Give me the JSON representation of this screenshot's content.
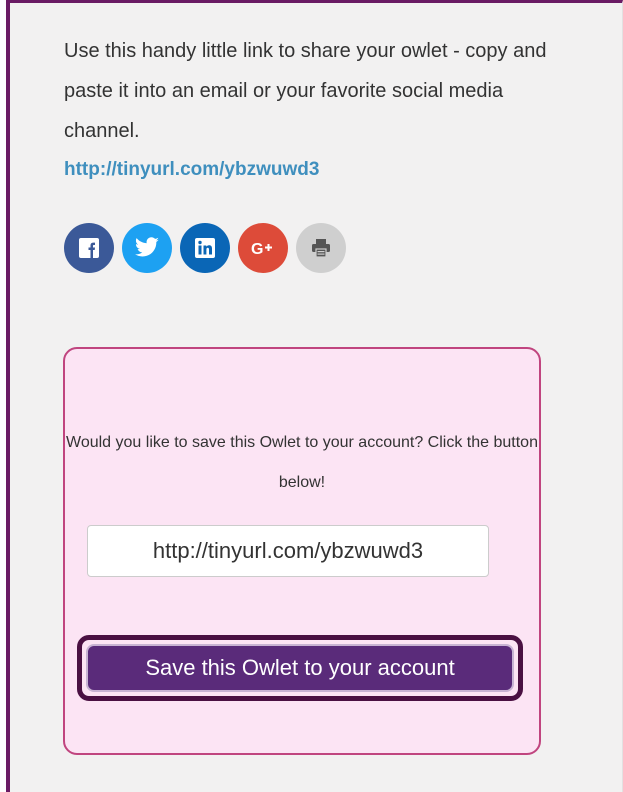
{
  "share": {
    "intro": "Use this handy little link to share your owlet - copy and paste it into an email or your favorite social media channel.",
    "link": "http://tinyurl.com/ybzwuwd3"
  },
  "socials": [
    {
      "name": "facebook",
      "icon": "facebook-icon",
      "color": "#3b5998"
    },
    {
      "name": "twitter",
      "icon": "twitter-icon",
      "color": "#1da1f2"
    },
    {
      "name": "linkedin",
      "icon": "linkedin-icon",
      "color": "#0a66b6"
    },
    {
      "name": "google-plus",
      "icon": "google-plus-icon",
      "color": "#dd4b39"
    },
    {
      "name": "print",
      "icon": "print-icon",
      "color": "#cfcfcf"
    }
  ],
  "save": {
    "prompt": "Would you like to save this Owlet to your account? Click the button below!",
    "url_value": "http://tinyurl.com/ybzwuwd3",
    "button_label": "Save this Owlet to your account"
  },
  "colors": {
    "accent": "#6a1b64",
    "link": "#3f8fbe",
    "save_box_bg": "#fce4f4",
    "button_bg": "#5a2b7a"
  }
}
